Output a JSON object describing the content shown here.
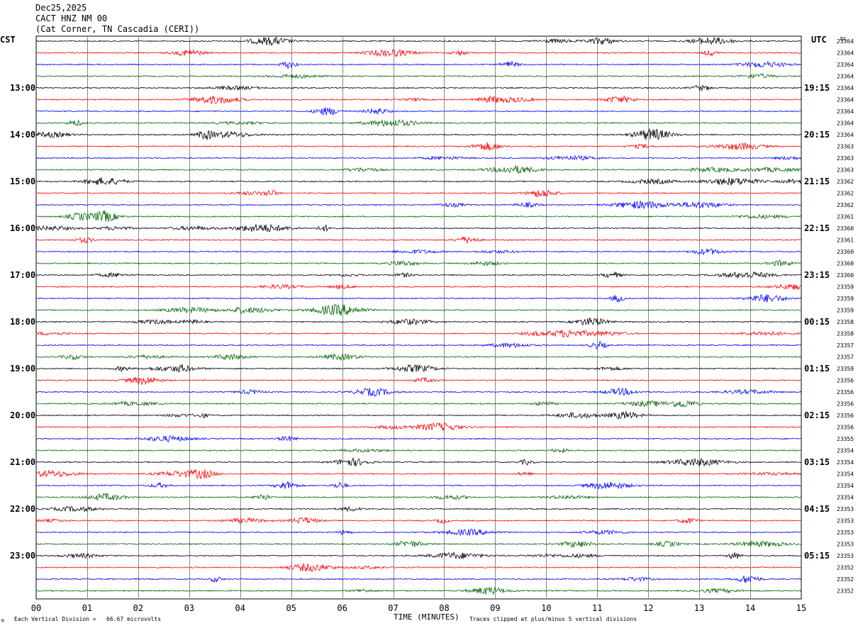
{
  "header": {
    "date": "Dec25,2025",
    "station": "CACT HNZ NM 00",
    "location": "(Cat Corner, TN Cascadia (CERI))"
  },
  "left_zone": "CST",
  "right_zone": "UTC",
  "dc_label": "DC",
  "footer": {
    "xlabel": "TIME (MINUTES)",
    "scale_note": "Each Vertical Division =   66.67 microvolts",
    "clip_note": "Traces clipped at plus/minus 5 vertical divisions",
    "corner_mark": "M"
  },
  "chart_data": {
    "type": "line",
    "title": "",
    "xlabel": "TIME (MINUTES)",
    "xlim": [
      0,
      15
    ],
    "x_ticks": [
      "00",
      "01",
      "02",
      "03",
      "04",
      "05",
      "06",
      "07",
      "08",
      "09",
      "10",
      "11",
      "12",
      "13",
      "14",
      "15"
    ],
    "trace_colors": [
      "#000000",
      "#ff0000",
      "#0000ff",
      "#006400"
    ],
    "left_hour_labels": [
      "13:00",
      "14:00",
      "15:00",
      "16:00",
      "17:00",
      "18:00",
      "19:00",
      "20:00",
      "21:00",
      "22:00",
      "23:00"
    ],
    "right_hour_labels": [
      "19:15",
      "20:15",
      "21:15",
      "22:15",
      "23:15",
      "00:15",
      "01:15",
      "02:15",
      "03:15",
      "04:15",
      "05:15"
    ],
    "dc_offsets": [
      "23364",
      "23364",
      "23364",
      "23364",
      "23364",
      "23364",
      "23364",
      "23364",
      "23364",
      "23363",
      "23363",
      "23363",
      "23362",
      "23362",
      "23362",
      "23361",
      "23360",
      "23361",
      "23360",
      "23360",
      "23360",
      "23359",
      "23359",
      "23359",
      "23358",
      "23358",
      "23357",
      "23357",
      "23359",
      "23356",
      "23356",
      "23356",
      "23356",
      "23356",
      "23355",
      "23354",
      "23354",
      "23354",
      "23354",
      "23354",
      "23353",
      "23353",
      "23353",
      "23353",
      "23353",
      "23352",
      "23352",
      "23352"
    ]
  }
}
